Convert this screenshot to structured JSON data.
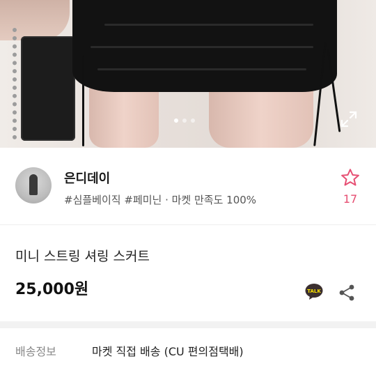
{
  "hero": {
    "image_alt": "product-photo-black-skirt",
    "pagination_active_index": 0,
    "pagination_count": 3
  },
  "seller": {
    "name": "은디데이",
    "tags": "#심플베이직 #페미닌",
    "satisfaction": "· 마켓 만족도 100%",
    "favorite_count": "17"
  },
  "product": {
    "title": "미니 스트링 셔링 스커트",
    "price": "25,000원"
  },
  "icons": {
    "expand": "expand-icon",
    "favorite": "star-outline-icon",
    "talk": "kakao-talk-icon",
    "share": "share-icon"
  },
  "shipping": {
    "label": "배송정보",
    "value": "마켓 직접 배송 (CU 편의점택배)"
  },
  "colors": {
    "accent_pink": "#e64e72",
    "price_text": "#111111",
    "muted": "#888888"
  }
}
